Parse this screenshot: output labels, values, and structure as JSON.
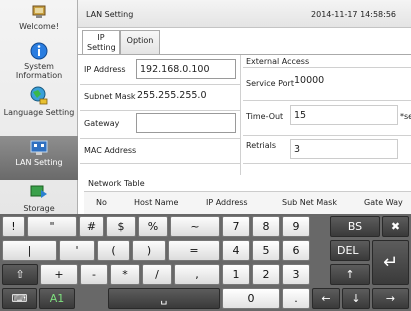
{
  "sidebar": {
    "items": [
      {
        "label": "Welcome!",
        "icon": "home-icon"
      },
      {
        "label": "System Information",
        "icon": "info-icon"
      },
      {
        "label": "Language Setting",
        "icon": "globe-icon"
      },
      {
        "label": "LAN Setting",
        "icon": "network-icon"
      },
      {
        "label": "Storage",
        "icon": "storage-icon"
      }
    ]
  },
  "header": {
    "title": "LAN Setting",
    "datetime": "2014-11-17 14:58:56"
  },
  "tabs": [
    {
      "label": "IP Setting"
    },
    {
      "label": "Option"
    }
  ],
  "form": {
    "ip_label": "IP Address",
    "ip_value": "192.168.0.100",
    "subnet_label": "Subnet Mask",
    "subnet_value": "255.255.255.0",
    "gateway_label": "Gateway",
    "gateway_value": "",
    "mac_label": "MAC Address",
    "mac_value": "",
    "external_access_label": "External Access",
    "service_port_label": "Service Port",
    "service_port_value": "10000",
    "timeout_label": "Time-Out",
    "timeout_value": "15",
    "timeout_unit": "*sec",
    "retrials_label": "Retrials",
    "retrials_value": "3"
  },
  "network_table": {
    "caption": "Network Table",
    "columns": [
      "No",
      "Host Name",
      "IP Address",
      "Sub Net Mask",
      "Gate Way"
    ]
  },
  "keyboard": {
    "row1": [
      "!",
      "\"",
      "#",
      "$",
      "%",
      "~",
      "7",
      "8",
      "9",
      "BS",
      "✖"
    ],
    "row2": [
      "|",
      "'",
      "(",
      ")",
      "=",
      "4",
      "5",
      "6",
      "DEL"
    ],
    "row3": [
      "⇧",
      "+",
      "-",
      "*",
      "/",
      ",",
      "1",
      "2",
      "3",
      "↑",
      "↵"
    ],
    "row4": [
      "⌨",
      "A1",
      "␣",
      "0",
      ".",
      "←",
      "↓",
      "→"
    ]
  },
  "colors": {
    "sidebar_active": "#7a7a7a",
    "keyboard_bg": "#686868",
    "dark_key": "#454545"
  }
}
